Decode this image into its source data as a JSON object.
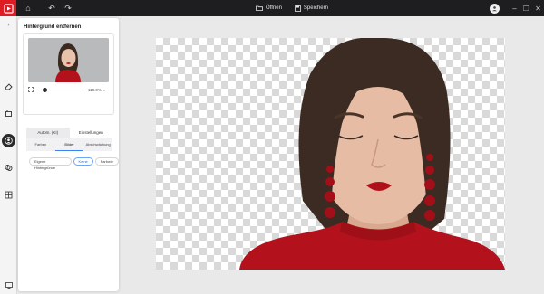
{
  "titlebar": {
    "open_label": "Öffnen",
    "save_label": "Speichern"
  },
  "panel": {
    "title": "Hintergrund entfernen",
    "zoom_value": "110.0%",
    "tabs": [
      {
        "label": "Autom. (KI)",
        "active": true
      },
      {
        "label": "Einstellungen",
        "active": false
      }
    ],
    "subtabs": [
      {
        "label": "Farben",
        "active": false
      },
      {
        "label": "Bilder",
        "active": true
      },
      {
        "label": "Abschwächung",
        "active": false
      }
    ],
    "bg_options": [
      {
        "label": "Eigene Hintergründe",
        "active": false
      },
      {
        "label": "Keine",
        "active": true
      },
      {
        "label": "Farbwie",
        "active": false
      }
    ]
  },
  "colors": {
    "accent_red": "#e01b24",
    "topbar_bg": "#1e1e20",
    "sweater_red": "#b3121c",
    "selection_blue": "#3b82f6"
  }
}
